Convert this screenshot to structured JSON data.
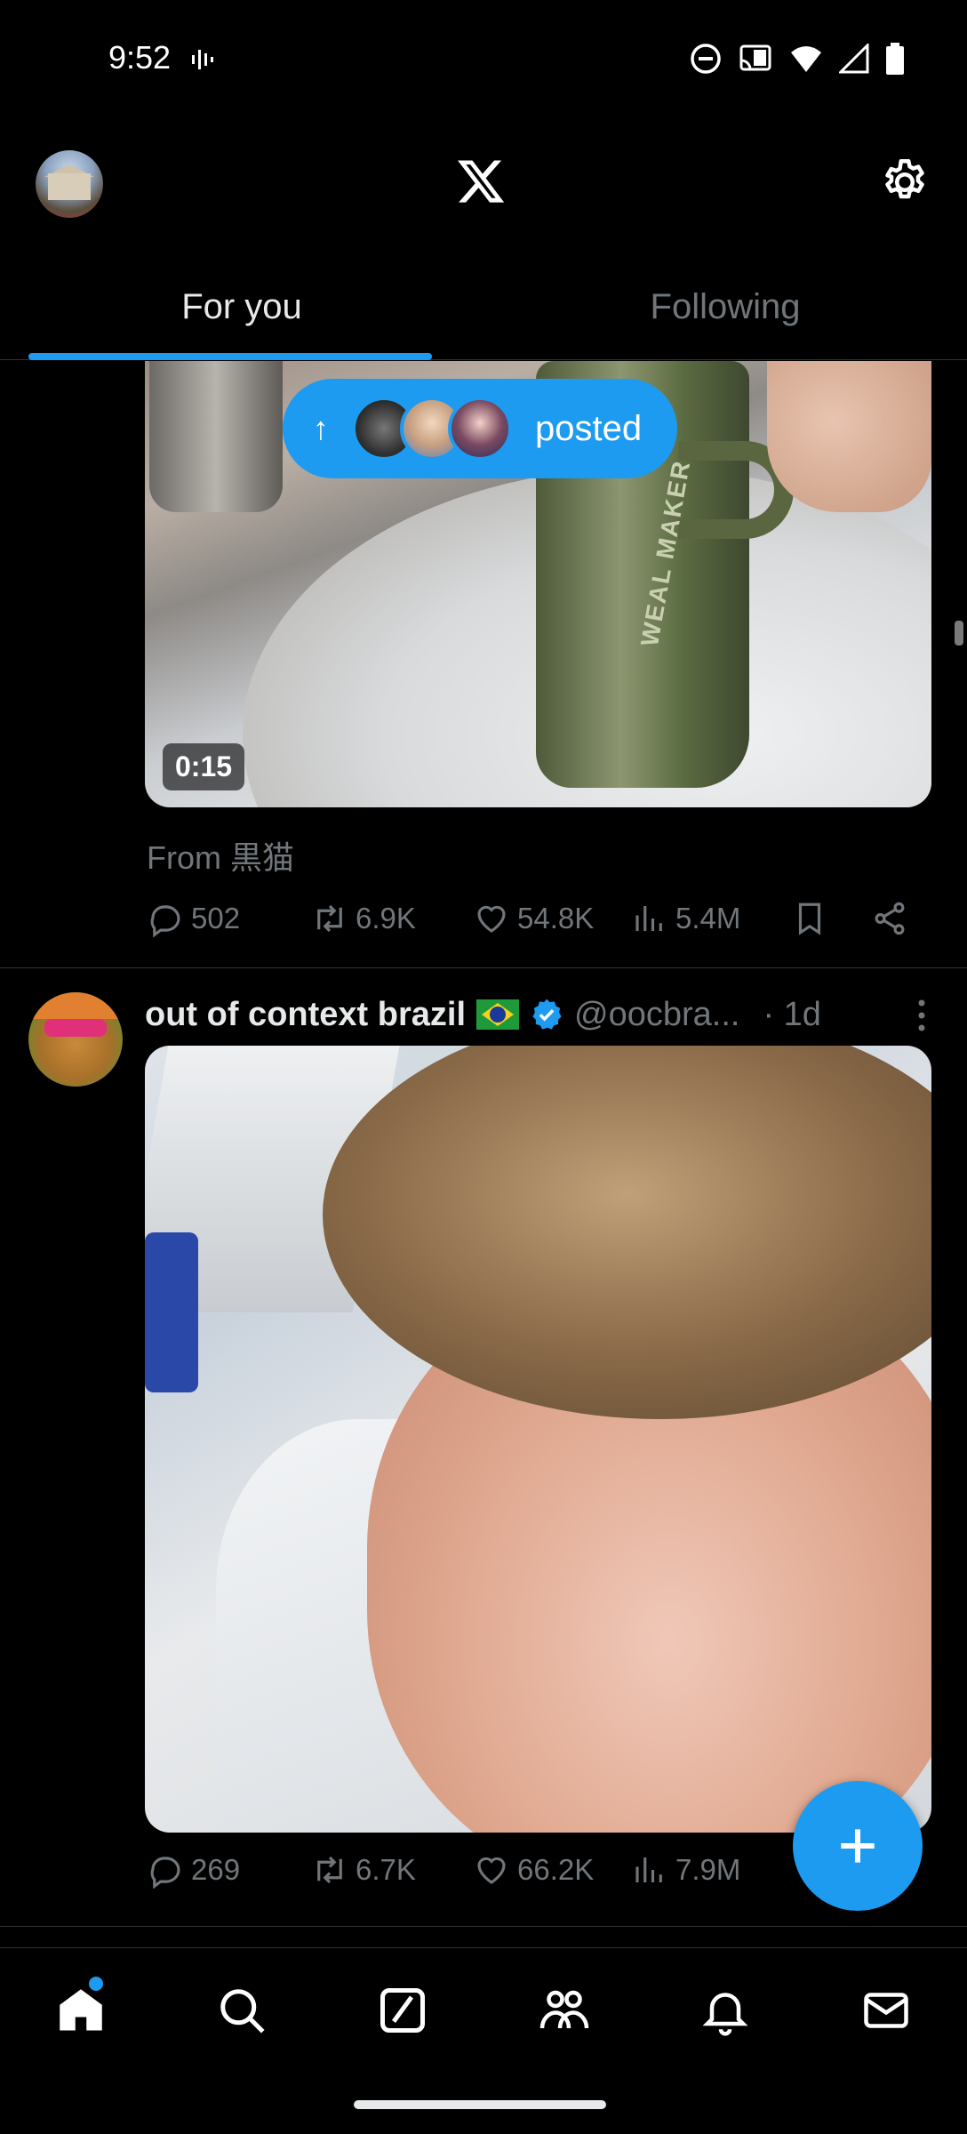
{
  "status_bar": {
    "time": "9:52"
  },
  "header": {
    "logo": "x-logo-icon"
  },
  "tabs": [
    {
      "label": "For you",
      "active": true
    },
    {
      "label": "Following",
      "active": false
    }
  ],
  "new_posts_pill": {
    "label": "posted"
  },
  "post1": {
    "video_duration": "0:15",
    "attribution": "From 黒猫",
    "stats": {
      "replies": "502",
      "reposts": "6.9K",
      "likes": "54.8K",
      "views": "5.4M"
    }
  },
  "post2": {
    "display_name": "out of context brazil",
    "handle": "@oocbra...",
    "time": "· 1d",
    "stats": {
      "replies": "269",
      "reposts": "6.7K",
      "likes": "66.2K",
      "views": "7.9M"
    }
  },
  "colors": {
    "accent": "#1d9bf0",
    "background": "#000000",
    "secondary_text": "#71767b",
    "primary_text": "#e7e9ea"
  },
  "bottom_nav": [
    {
      "name": "home-icon",
      "active": true
    },
    {
      "name": "search-icon",
      "active": false
    },
    {
      "name": "grok-icon",
      "active": false
    },
    {
      "name": "communities-icon",
      "active": false
    },
    {
      "name": "notifications-icon",
      "active": false
    },
    {
      "name": "messages-icon",
      "active": false
    }
  ]
}
